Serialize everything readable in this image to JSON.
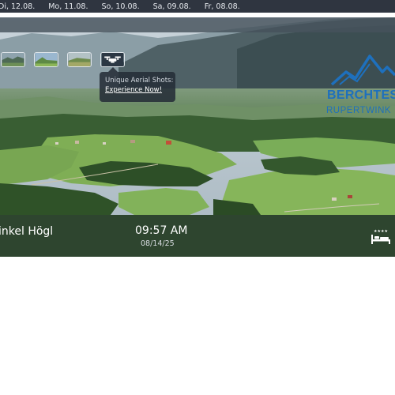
{
  "date_bar": {
    "dates": [
      "Di, 12.08.",
      "Mo, 11.08.",
      "So, 10.08.",
      "Sa, 09.08.",
      "Fr, 08.08."
    ]
  },
  "tooltip": {
    "line1": "Unique Aerial Shots:",
    "link": "Experience Now!"
  },
  "logo": {
    "name": "BERCHTES",
    "sub": "RUPERTWINK",
    "color": "#1e70bd"
  },
  "overlay": {
    "location": "inkel Högl",
    "time": "09:57 AM",
    "date": "08/14/25"
  },
  "icons": {
    "thumbnails": [
      "mountain-view-thumb",
      "valley-thumb",
      "hill-thumb",
      "drone-thumb"
    ],
    "hotel": "hotel-bed-icon"
  }
}
